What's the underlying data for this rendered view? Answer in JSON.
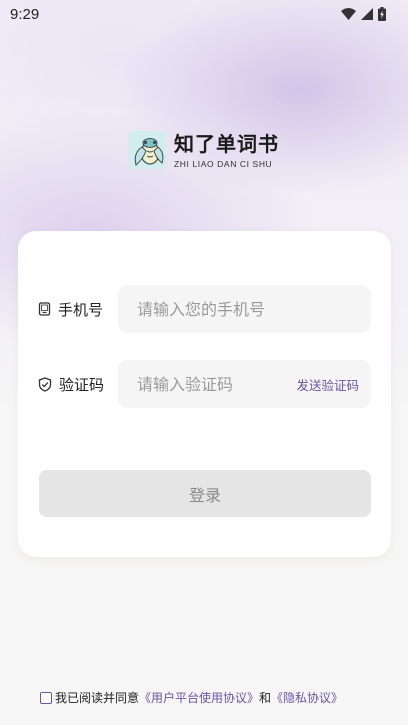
{
  "status_bar": {
    "time": "9:29",
    "icons": [
      "wifi-icon",
      "signal-icon",
      "battery-charging-icon"
    ]
  },
  "brand": {
    "title": "知了单词书",
    "subtitle": "ZHI LIAO DAN CI SHU",
    "logo_icon": "cicada-logo-icon"
  },
  "form": {
    "phone": {
      "label": "手机号",
      "icon": "phone-icon",
      "placeholder": "请输入您的手机号",
      "value": ""
    },
    "code": {
      "label": "验证码",
      "icon": "shield-check-icon",
      "placeholder": "请输入验证码",
      "value": "",
      "send_label": "发送验证码"
    },
    "login_label": "登录"
  },
  "agreement": {
    "checked": false,
    "prefix": "我已阅读并同意",
    "user_agreement": "《用户平台使用协议》",
    "conjunction": "和",
    "privacy_policy": "《隐私协议》"
  },
  "colors": {
    "accent": "#6a54a6",
    "button_disabled_bg": "#e5e5e5",
    "field_bg": "#f5f5f5"
  }
}
